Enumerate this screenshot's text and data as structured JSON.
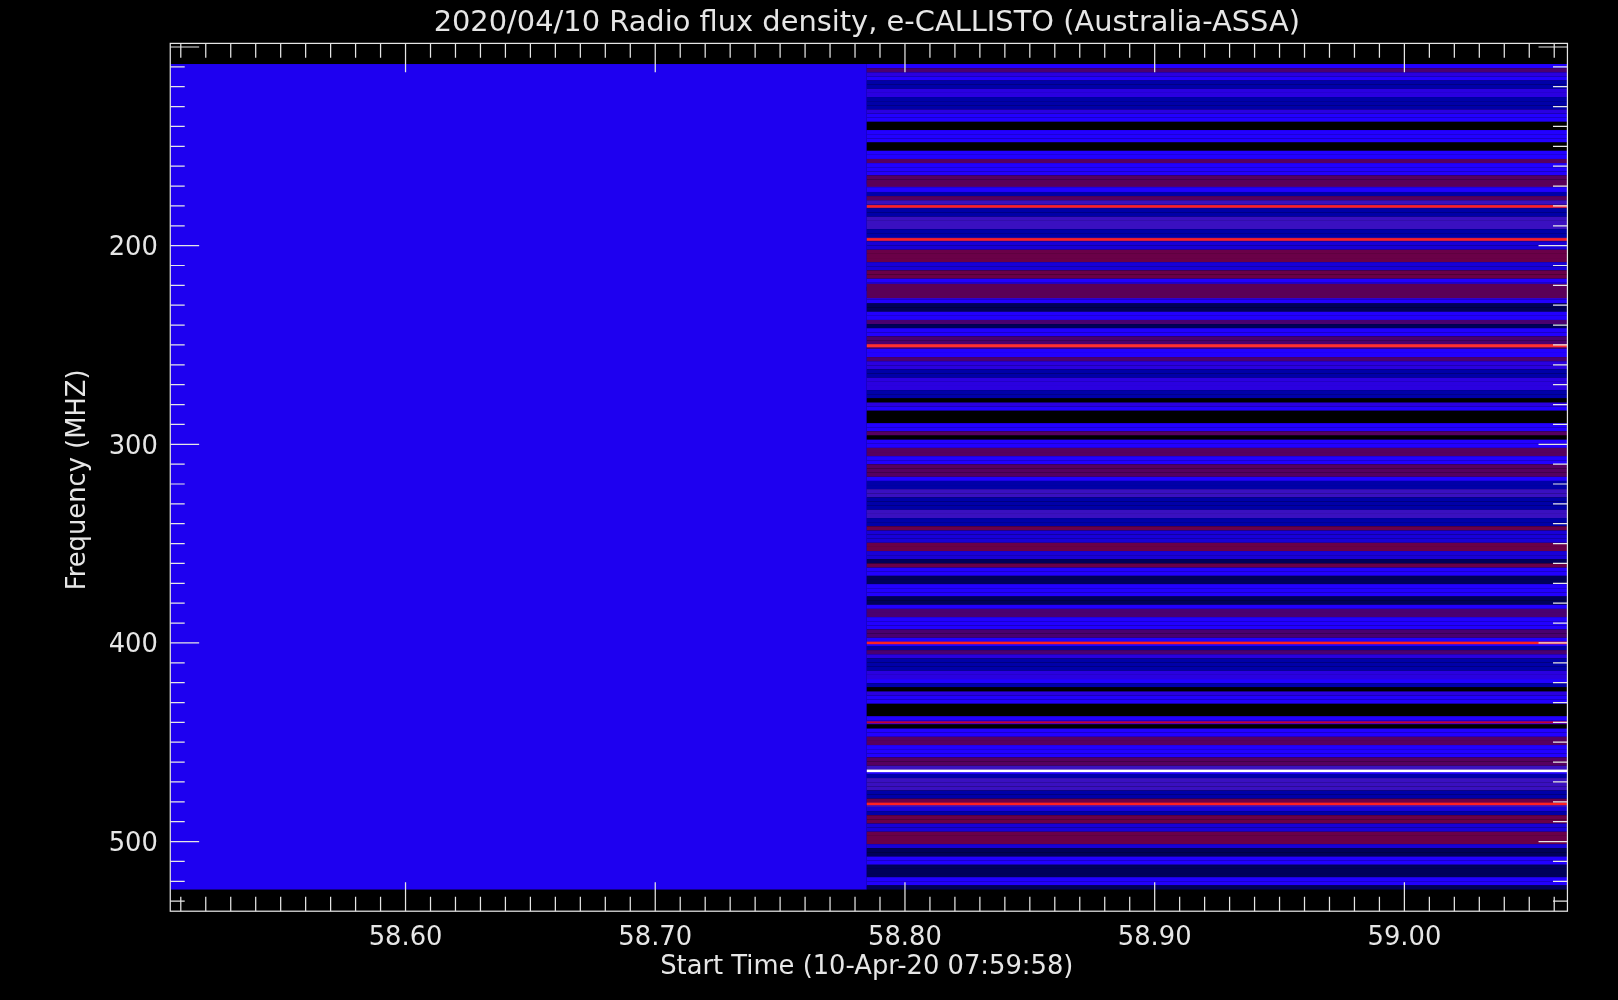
{
  "title": "2020/04/10  Radio flux density, e-CALLISTO (Australia-ASSA)",
  "y_axis": {
    "label": "Frequency (MHZ)",
    "ticks": [
      "200",
      "300",
      "400",
      "500"
    ]
  },
  "x_axis": {
    "label": "Start Time (10-Apr-20 07:59:58)",
    "ticks": [
      "58.60",
      "58.70",
      "58.80",
      "58.90",
      "59.00"
    ]
  }
}
